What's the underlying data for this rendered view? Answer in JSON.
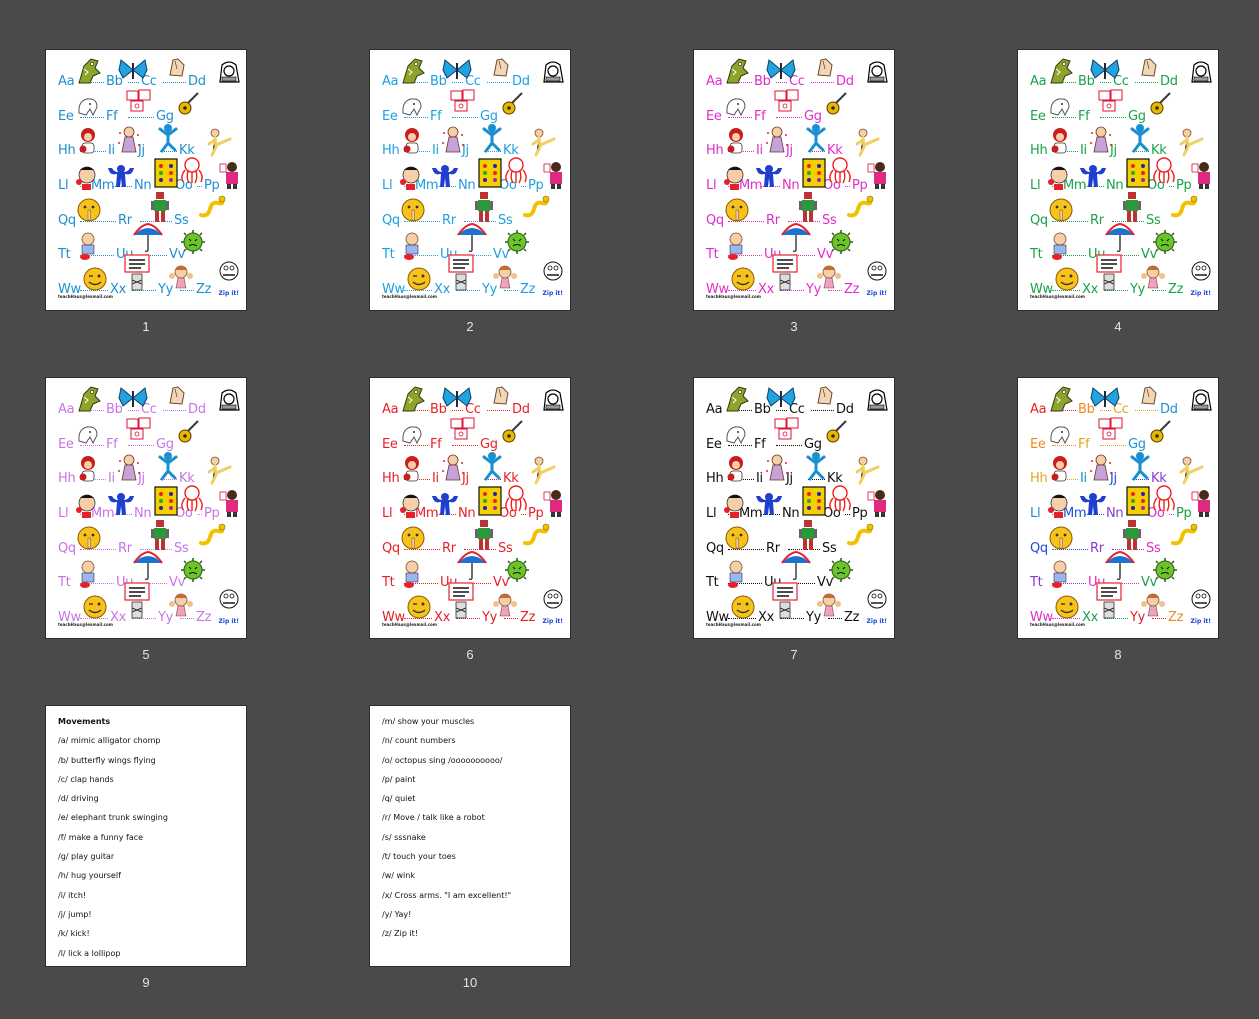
{
  "thumbnails": [
    {
      "number": "1",
      "type": "alphabet",
      "color": "#1e8fd0"
    },
    {
      "number": "2",
      "type": "alphabet",
      "color": "#1ea0e0"
    },
    {
      "number": "3",
      "type": "alphabet",
      "color": "#e02cc8"
    },
    {
      "number": "4",
      "type": "alphabet",
      "color": "#18a24a"
    },
    {
      "number": "5",
      "type": "alphabet",
      "color": "#c774e8"
    },
    {
      "number": "6",
      "type": "alphabet",
      "color": "#e8202a"
    },
    {
      "number": "7",
      "type": "alphabet",
      "color": "#111111"
    },
    {
      "number": "8",
      "type": "alphabet",
      "color": "mixed"
    },
    {
      "number": "9",
      "type": "text",
      "lines": [
        "Movements",
        "/a/ mimic alligator chomp",
        "/b/ butterfly wings flying",
        "/c/ clap hands",
        "/d/ driving",
        "/e/ elephant trunk swinging",
        "/f/ make a funny face",
        "/g/ play guitar",
        "/h/ hug yourself",
        "/i/ itch!",
        "/j/ jump!",
        "/k/ kick!",
        "/l/ lick a lollipop"
      ]
    },
    {
      "number": "10",
      "type": "text",
      "lines": [
        "/m/ show your muscles",
        "/n/ count numbers",
        "/o/ octopus sing /oooooooooo/",
        "/p/ paint",
        "/q/ quiet",
        "/r/ Move / talk like a robot",
        "/s/ sssnake",
        "/t/ touch your toes",
        "/w/ wink",
        "/x/ Cross arms. \"I am excellent!\"",
        "/y/ Yay!",
        "/z/ Zip it!"
      ]
    }
  ],
  "alphabet_rows": [
    [
      "Aa",
      "Bb",
      "Cc",
      "Dd"
    ],
    [
      "Ee",
      "Ff",
      "Gg"
    ],
    [
      "Hh",
      "Ii",
      "Jj",
      "Kk"
    ],
    [
      "Ll",
      "Mm",
      "Nn",
      "Oo",
      "Pp"
    ],
    [
      "Qq",
      "Rr",
      "Ss"
    ],
    [
      "Tt",
      "Uu",
      "Vv"
    ],
    [
      "Ww",
      "Xx",
      "Yy",
      "Zz"
    ]
  ],
  "page_labels": {
    "footer": "teachHaus@lexmail.com",
    "zip_it": "Zip it!"
  },
  "multi_palette": {
    "a": "#e8202a",
    "b": "#f08a1e",
    "c": "#e0a81e",
    "d": "#1e8fd0",
    "e": "#1e4fd8",
    "f": "#8a3ad0",
    "g": "#e02cc8",
    "h": "#18a24a"
  },
  "icons": [
    "alligator-icon",
    "butterfly-icon",
    "clap-hands-icon",
    "car-icon",
    "elephant-icon",
    "funny-face-icon",
    "guitar-icon",
    "hug-icon",
    "itch-icon",
    "jump-icon",
    "kick-icon",
    "lollipop-icon",
    "muscles-icon",
    "numbers-icon",
    "octopus-icon",
    "paint-icon",
    "quiet-icon",
    "robot-icon",
    "snake-icon",
    "toes-icon",
    "umbrella-icon",
    "virus-icon",
    "wink-icon",
    "excellent-sign-icon",
    "yay-icon",
    "zip-face-icon"
  ]
}
